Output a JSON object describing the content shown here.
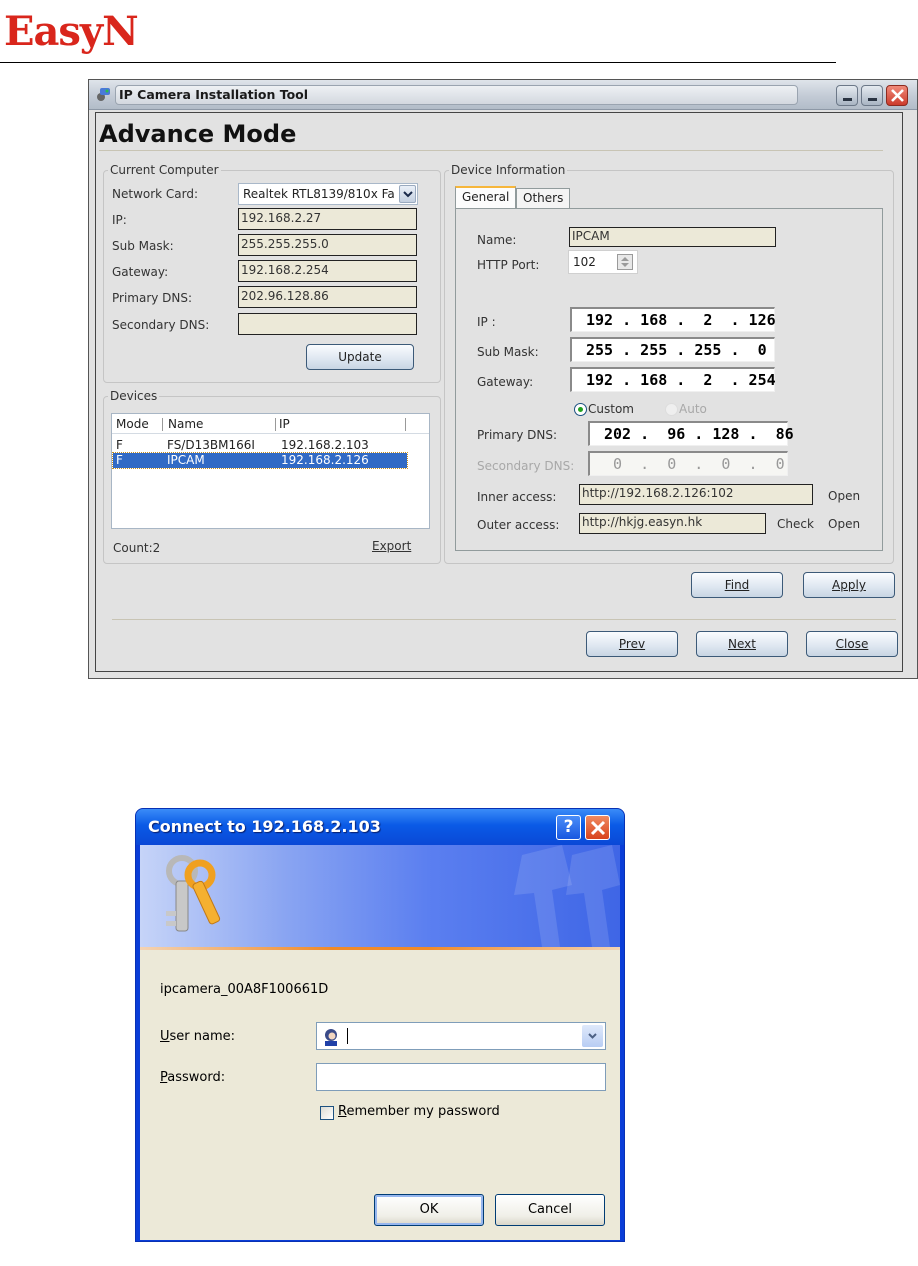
{
  "page": {
    "logo": "EasyN"
  },
  "tool_window": {
    "title": "IP Camera Installation Tool",
    "heading": "Advance Mode",
    "current_computer": {
      "legend": "Current Computer",
      "network_card_label": "Network Card:",
      "network_card_value": "Realtek RTL8139/810x Fa",
      "ip_label": "IP:",
      "ip_value": "192.168.2.27",
      "submask_label": "Sub Mask:",
      "submask_value": "255.255.255.0",
      "gateway_label": "Gateway:",
      "gateway_value": "192.168.2.254",
      "primary_dns_label": "Primary DNS:",
      "primary_dns_value": "202.96.128.86",
      "secondary_dns_label": "Secondary DNS:",
      "secondary_dns_value": "",
      "update_button": "Update"
    },
    "devices": {
      "legend": "Devices",
      "columns": [
        "Mode",
        "Name",
        "IP"
      ],
      "rows": [
        {
          "mode": "F",
          "name": "FS/D13BM166I",
          "ip": "192.168.2.103",
          "selected": false
        },
        {
          "mode": "F",
          "name": "IPCAM",
          "ip": "192.168.2.126",
          "selected": true
        }
      ],
      "count_label": "Count:2",
      "export_link": "Export"
    },
    "device_information": {
      "legend": "Device Information",
      "tabs": [
        {
          "label": "General",
          "active": true
        },
        {
          "label": "Others",
          "active": false
        }
      ],
      "name_label": "Name:",
      "name_value": "IPCAM",
      "http_port_label": "HTTP Port:",
      "http_port_value": "102",
      "ip_label": "IP  :",
      "ip_value": "192 . 168 .  2  . 126",
      "submask_label": "Sub Mask:",
      "submask_value": "255 . 255 . 255 .  0",
      "gateway_label": "Gateway:",
      "gateway_value": "192 . 168 .  2  . 254",
      "dns_mode_custom": "Custom",
      "dns_mode_auto": "Auto",
      "dns_mode_selected": "Custom",
      "primary_dns_label": "Primary DNS:",
      "primary_dns_value": "202 .  96 . 128 .  86",
      "secondary_dns_label": "Secondary DNS:",
      "secondary_dns_value": " 0  .  0  .  0  .  0",
      "inner_access_label": "Inner access:",
      "inner_access_value": "http://192.168.2.126:102",
      "outer_access_label": "Outer access:",
      "outer_access_value": "http://hkjg.easyn.hk",
      "open_link": "Open",
      "check_link": "Check"
    },
    "buttons": {
      "find": "Find",
      "apply": "Apply",
      "prev": "Prev",
      "next": "Next",
      "close": "Close"
    }
  },
  "login_dialog": {
    "title": "Connect to 192.168.2.103",
    "realm": "ipcamera_00A8F100661D",
    "username_label": "User name:",
    "username_value": "",
    "password_label": "Password:",
    "password_value": "",
    "remember_label": "Remember my password",
    "remember_checked": false,
    "ok_button": "OK",
    "cancel_button": "Cancel"
  }
}
